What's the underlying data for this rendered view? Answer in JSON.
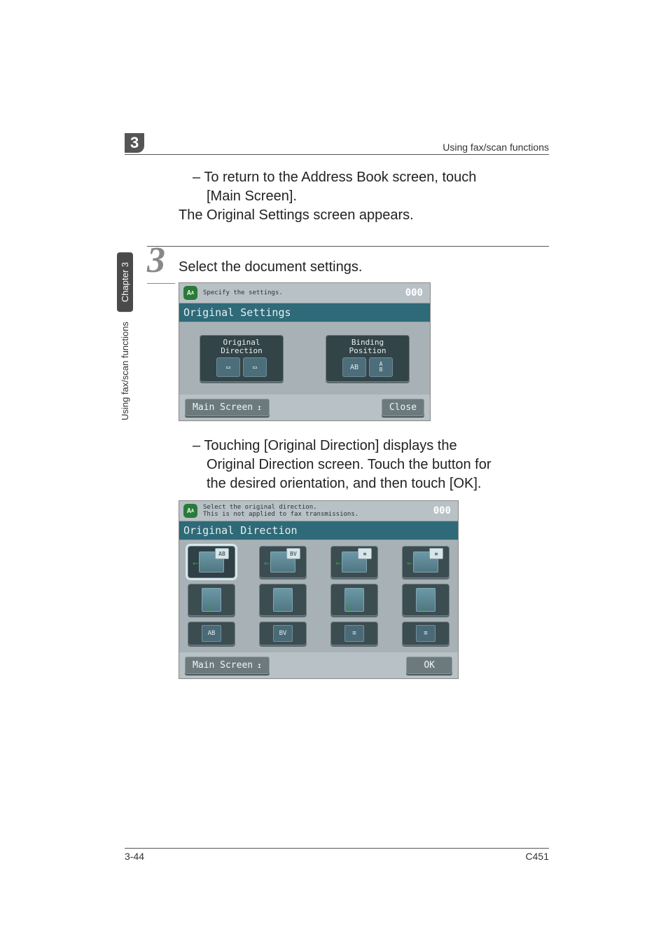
{
  "header": {
    "chapter_number": "3",
    "title": "Using fax/scan functions"
  },
  "side": {
    "dark": "Chapter 3",
    "light": "Using fax/scan functions"
  },
  "intro": {
    "bullet_a": "– To return to the Address Book screen, touch",
    "bullet_a2": "[Main Screen].",
    "line2": "The Original Settings screen appears."
  },
  "step": {
    "number": "3",
    "heading": "Select the document settings."
  },
  "panel1": {
    "hint": "Specify the settings.",
    "counter": "000",
    "title": "Original Settings",
    "option1_line1": "Original",
    "option1_line2": "Direction",
    "option2_line1": "Binding",
    "option2_line2": "Position",
    "icon_ab": "AB",
    "icon_ab_stack": "A\nB",
    "main_screen": "Main Screen",
    "close": "Close"
  },
  "mid_text": {
    "l1": "– Touching [Original Direction] displays the",
    "l2": "Original Direction screen. Touch the button for",
    "l3": "the desired orientation, and then touch [OK]."
  },
  "panel2": {
    "hint1": "Select the original direction.",
    "hint2": "This is not applied to fax transmissions.",
    "counter": "000",
    "title": "Original Direction",
    "badge_ab": "AB",
    "badge_bv": "BV",
    "main_screen": "Main Screen",
    "ok": "OK"
  },
  "footer": {
    "left": "3-44",
    "right": "C451"
  }
}
